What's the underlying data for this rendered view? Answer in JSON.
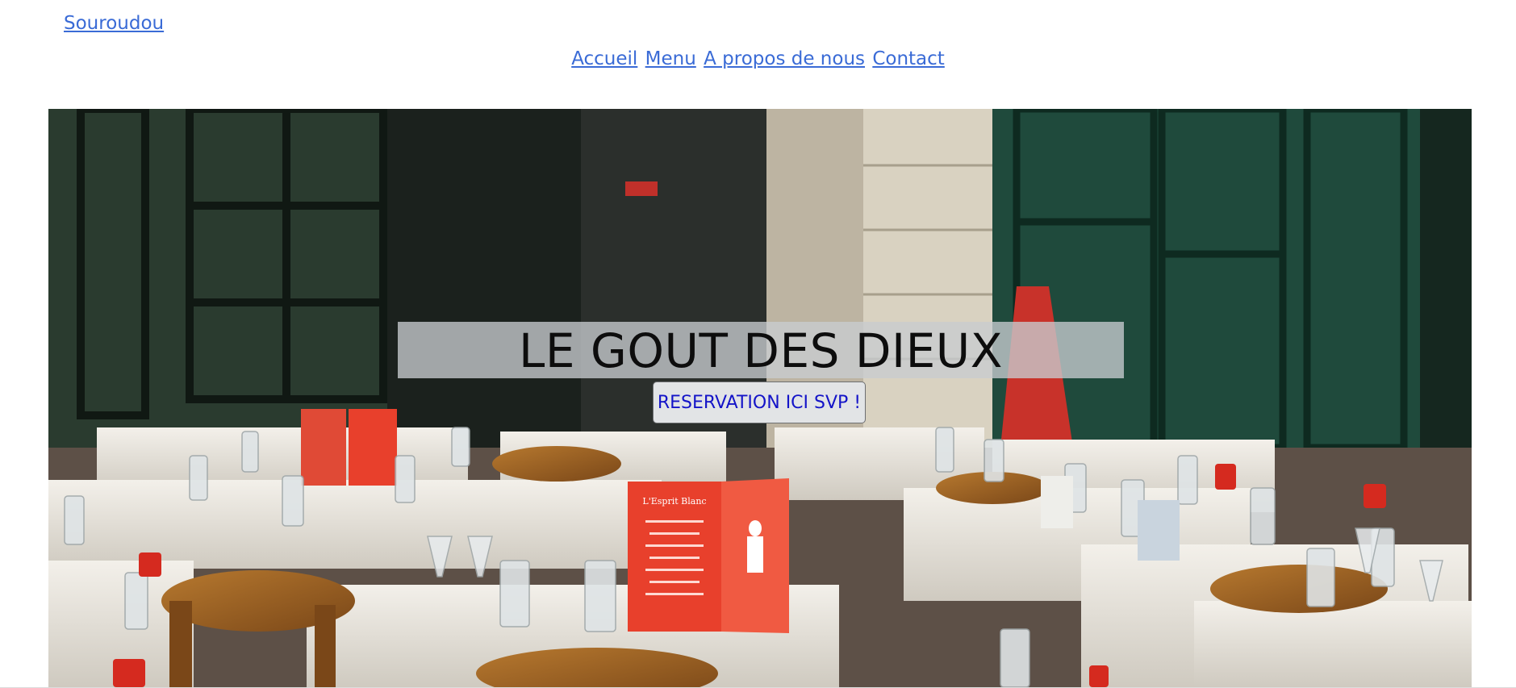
{
  "brand": {
    "name": "Souroudou"
  },
  "nav": {
    "items": [
      {
        "label": "Accueil"
      },
      {
        "label": "Menu"
      },
      {
        "label": "A propos de nous"
      },
      {
        "label": "Contact"
      }
    ]
  },
  "hero": {
    "title": "LE GOUT DES DIEUX",
    "reserve_label": "RESERVATION ICI SVP !",
    "menu_card_text": "L'Esprit Blanc",
    "image_subject": "restaurant-terrace-photo"
  },
  "colors": {
    "link": "#3a6bd6",
    "button_text": "#1414c8",
    "title_text": "#0d0d0d",
    "title_band": "#c8ccd0",
    "menu_red": "#e8402c"
  }
}
